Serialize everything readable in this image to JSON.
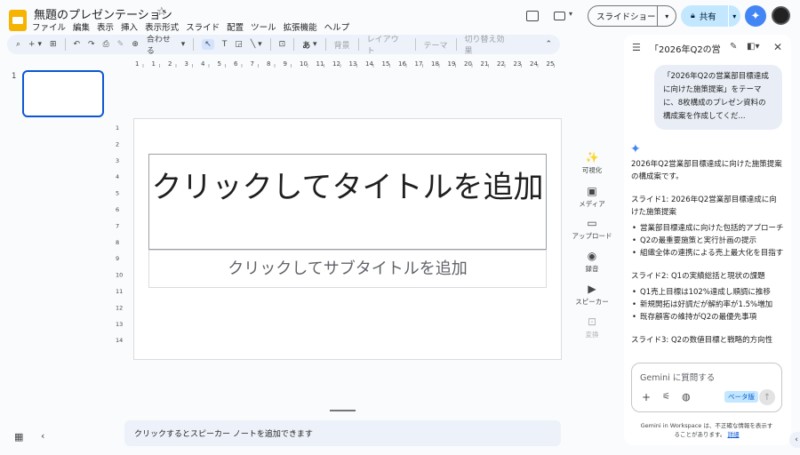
{
  "header": {
    "doc_title": "無題のプレゼンテーション",
    "menu": [
      "ファイル",
      "編集",
      "表示",
      "挿入",
      "表示形式",
      "スライド",
      "配置",
      "ツール",
      "拡張機能",
      "ヘルプ"
    ],
    "slideshow_label": "スライドショー",
    "share_label": "共有"
  },
  "toolbar": {
    "zoom_label": "合わせる",
    "font_label": "あ",
    "background_label": "背景",
    "layout_label": "レイアウト",
    "theme_label": "テーマ",
    "transition_label": "切り替え効果"
  },
  "filmstrip": {
    "slide_number": "1"
  },
  "rulers": {
    "h": [
      "1",
      "1",
      "2",
      "3",
      "4",
      "5",
      "6",
      "7",
      "8",
      "9",
      "10",
      "11",
      "12",
      "13",
      "14",
      "15",
      "16",
      "17",
      "18",
      "19",
      "20",
      "21",
      "22",
      "23",
      "24",
      "25"
    ],
    "v": [
      "1",
      "2",
      "3",
      "4",
      "5",
      "6",
      "7",
      "8",
      "9",
      "10",
      "11",
      "12",
      "13",
      "14"
    ]
  },
  "slide": {
    "title_placeholder": "クリックしてタイトルを追加",
    "subtitle_placeholder": "クリックしてサブタイトルを追加"
  },
  "notes_placeholder": "クリックするとスピーカー ノートを追加できます",
  "side_tools": [
    {
      "label": "可視化",
      "icon": "magic-wand-icon"
    },
    {
      "label": "メディア",
      "icon": "image-icon"
    },
    {
      "label": "アップロード",
      "icon": "folder-icon"
    },
    {
      "label": "録音",
      "icon": "record-icon"
    },
    {
      "label": "スピーカー",
      "icon": "camera-icon"
    },
    {
      "label": "変換",
      "icon": "convert-icon"
    }
  ],
  "gemini": {
    "panel_title": "「2026年Q2の営…",
    "user_message": "「2026年Q2の営業部目標達成に向けた施策提案」をテーマに、8枚構成のプレゼン資料の構成案を作成してくだ...",
    "answer": {
      "intro": "2026年Q2営業部目標達成に向けた施策提案の構成案です。",
      "s1_title": "スライド1: 2026年Q2営業部目標達成に向けた施策提案",
      "s1_items": [
        "営業部目標達成に向けた包括的アプローチ",
        "Q2の最重要施策と実行計画の提示",
        "組織全体の連携による売上最大化を目指す"
      ],
      "s2_title": "スライド2: Q1の実績総括と現状の課題",
      "s2_items": [
        "Q1売上目標は102%達成し順調に推移",
        "新規開拓は好調だが解約率が1.5%増加",
        "既存顧客の維持がQ2の最優先事項"
      ],
      "s3_title": "スライド3: Q2の数値目標と戦略的方向性"
    },
    "input_placeholder": "Gemini に質問する",
    "beta_label": "ベータ版",
    "disclaimer": "Gemini in Workspace は、不正確な情報を表示することがあります。",
    "disclaimer_link": "詳細"
  },
  "colors": {
    "accent": "#0b57d0",
    "share_bg": "#c2e7ff",
    "toolbar_bg": "#edf2fa",
    "gemini_blue": "#4285f4"
  }
}
